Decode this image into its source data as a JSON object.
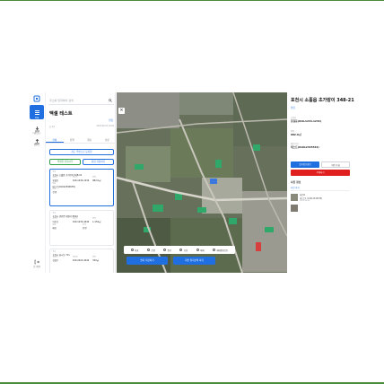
{
  "rail": {
    "items": [
      {
        "label": "목록"
      },
      {
        "label": "다운로드"
      },
      {
        "label": "업로드"
      }
    ],
    "logout_label": "로그아웃"
  },
  "panel": {
    "search_placeholder": "주소를 입력하여 검색",
    "title": "맥셀 테스트",
    "edit_label": "편집",
    "sub_left": "총 3건",
    "sub_right": "2023.06.05 10:00",
    "tabs": [
      "전체",
      "진행",
      "완료",
      "보류"
    ],
    "add_button": "지도 주변으로 등록함",
    "action_left": "맥셀을 만들어주",
    "action_right": "지점 저장하기",
    "cards": [
      {
        "label_addr": "주소",
        "address": "포천시 소흘읍 초가랑이 348-21",
        "owner_label": "소유자",
        "owner": "홍길동",
        "phone_label": "연락처",
        "phone": "010-1234-1234",
        "area_label": "면적",
        "area": "982.0㎡",
        "note_label": "메모",
        "note": "테스트(01012345678)",
        "status_label": "상태",
        "status": "진행"
      },
      {
        "label_addr": "주소",
        "address": "포천시 관인면 냉정리 6524",
        "owner_label": "소유자",
        "owner": "이순신",
        "phone_label": "연락처",
        "phone": "010-1234-4444",
        "area_label": "면적",
        "area": "1,154㎡",
        "note_label": "메모",
        "note": "메모",
        "status_label": "상태",
        "status": "진행"
      },
      {
        "label_addr": "주소",
        "address": "포천시 화시동 711",
        "owner_label": "소유자",
        "owner": "김철수",
        "phone_label": "연락처",
        "phone": "010-2222-4444",
        "area_label": "면적",
        "area": "320㎡",
        "note_label": "메모",
        "note": "메모",
        "status_label": "상태",
        "status": "진행"
      }
    ]
  },
  "map": {
    "close_glyph": "×",
    "legend": [
      "대표",
      "진행",
      "완료",
      "보류",
      "재매",
      "재매완료(분)"
    ],
    "button_left": "필지 저장하기",
    "button_right": "지번 필지선택 하기"
  },
  "detail": {
    "title": "포천시 소흘읍 초가랑이 348-21",
    "badge": "편집",
    "owner_label": "소유자",
    "owner": "홍길동(010-1234-1234)",
    "area_label": "면적",
    "area": "982.0㎡",
    "note_label": "메모/기타",
    "note": "테스트(01012345534)",
    "btn_blue": "필지정보확인",
    "btn_white": "지번 조회",
    "btn_red": "삭제하기",
    "photo_section": "사진 정보",
    "photo_link": "사진 추가",
    "photo_name": "사진1",
    "photo_caption": "테스트1 (01012345678)",
    "photo_meta": "2023.06.05"
  },
  "colors": {
    "accent": "#1f6fe0",
    "danger": "#e0201f",
    "frame": "#4a8a3a"
  }
}
